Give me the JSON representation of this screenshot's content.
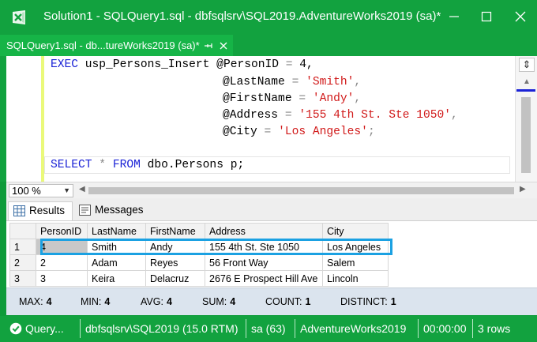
{
  "window": {
    "title": "Solution1 - SQLQuery1.sql - dbfsqlsrv\\SQL2019.AdventureWorks2019 (sa)*",
    "minimize_icon": "minimize-icon",
    "maximize_icon": "maximize-icon",
    "close_icon": "close-icon"
  },
  "doc_tab": {
    "label": "SQLQuery1.sql - db...tureWorks2019 (sa)*",
    "pin_icon": "pin-icon",
    "close_icon": "close-icon"
  },
  "editor": {
    "lines": [
      {
        "kw": "EXEC",
        "rest": " usp_Persons_Insert @PersonID ",
        "op": "=",
        "tail": " 4,"
      },
      {
        "param": "@LastName ",
        "op": "=",
        "str": "'Smith'",
        "tail": ","
      },
      {
        "param": "@FirstName ",
        "op": "=",
        "str": "'Andy'",
        "tail": ","
      },
      {
        "param": "@Address ",
        "op": "=",
        "str": "'155 4th St. Ste 1050'",
        "tail": ","
      },
      {
        "param": "@City ",
        "op": "=",
        "str": "'Los Angeles'",
        "tail": ";"
      },
      {
        "kw": "SELECT",
        "star": " * ",
        "kw2": "FROM",
        "rest": " dbo.Persons p;"
      }
    ],
    "colors": {
      "keyword": "#1a22d6",
      "string": "#d11a1a",
      "operator": "#888888"
    }
  },
  "zoom": {
    "value": "100 %"
  },
  "results_tabs": [
    {
      "label": "Results",
      "icon": "grid-icon"
    },
    {
      "label": "Messages",
      "icon": "messages-icon"
    }
  ],
  "grid": {
    "columns": [
      "PersonID",
      "LastName",
      "FirstName",
      "Address",
      "City"
    ],
    "rows": [
      {
        "n": "1",
        "cells": [
          "4",
          "Smith",
          "Andy",
          "155 4th St. Ste 1050",
          "Los Angeles"
        ]
      },
      {
        "n": "2",
        "cells": [
          "2",
          "Adam",
          "Reyes",
          "56 Front Way",
          "Salem"
        ]
      },
      {
        "n": "3",
        "cells": [
          "3",
          "Keira",
          "Delacruz",
          "2676 E Prospect Hill Ave",
          "Lincoln"
        ]
      }
    ],
    "highlight_color": "#1ba1e2"
  },
  "aggregates": {
    "max": {
      "label": "MAX:",
      "value": "4"
    },
    "min": {
      "label": "MIN:",
      "value": "4"
    },
    "avg": {
      "label": "AVG:",
      "value": "4"
    },
    "sum": {
      "label": "SUM:",
      "value": "4"
    },
    "count": {
      "label": "COUNT:",
      "value": "1"
    },
    "distinct": {
      "label": "DISTINCT:",
      "value": "1"
    }
  },
  "status": {
    "query": "Query...",
    "server": "dbfsqlsrv\\SQL2019 (15.0 RTM)",
    "user": "sa (63)",
    "database": "AdventureWorks2019",
    "time": "00:00:00",
    "rows": "3 rows",
    "ok_icon": "check-circle-icon",
    "color": "#12a23f"
  }
}
